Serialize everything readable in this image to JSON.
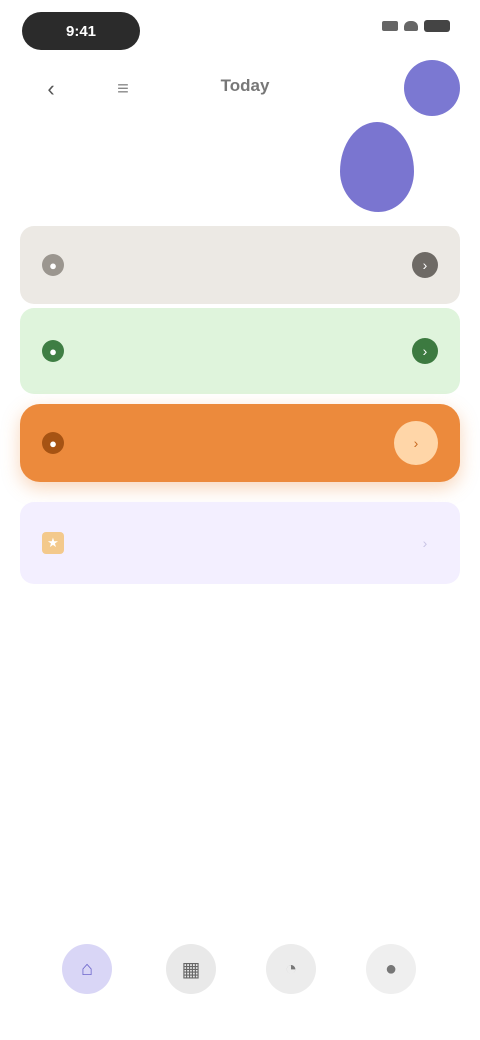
{
  "status_bar": {
    "time": "9:41"
  },
  "header": {
    "back_glyph": "‹",
    "menu_glyph": "≡",
    "title": "Today"
  },
  "subtitle": "",
  "cards": [
    {
      "title": "",
      "subtitle": "",
      "lead_glyph": "●",
      "trail_glyph": "›"
    },
    {
      "title": "",
      "subtitle": "",
      "lead_glyph": "●",
      "trail_glyph": "›"
    },
    {
      "title": "",
      "subtitle": "",
      "lead_glyph": "●",
      "trail_glyph": "›"
    },
    {
      "title": "",
      "subtitle": "",
      "lead_glyph": "★",
      "trail_glyph": "›"
    }
  ],
  "hint": "",
  "bottom_nav": [
    {
      "icon": "home-icon",
      "glyph": "⌂"
    },
    {
      "icon": "calendar-icon",
      "glyph": "▦"
    },
    {
      "icon": "chart-icon",
      "glyph": "◔"
    },
    {
      "icon": "profile-icon",
      "glyph": "●"
    }
  ],
  "colors": {
    "accent": "#7b78d2",
    "card_neutral": "#ece9e4",
    "card_green": "#dff4dc",
    "card_orange": "#ec8a3c",
    "card_lavender": "#f3efff"
  }
}
